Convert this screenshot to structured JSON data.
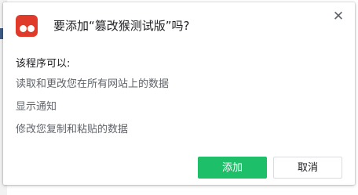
{
  "dialog": {
    "title": "要添加“篡改猴测试版”吗?",
    "close_glyph": "✕",
    "permissions_heading": "该程序可以:",
    "permissions": [
      "读取和更改您在所有网站上的数据",
      "显示通知",
      "修改您复制和粘贴的数据"
    ],
    "add_label": "添加",
    "cancel_label": "取消"
  },
  "colors": {
    "icon_bg": "#e03a2a",
    "add_button_bg": "#1dbf68"
  },
  "icons": {
    "app": "extension-app-icon",
    "close": "close-icon"
  }
}
